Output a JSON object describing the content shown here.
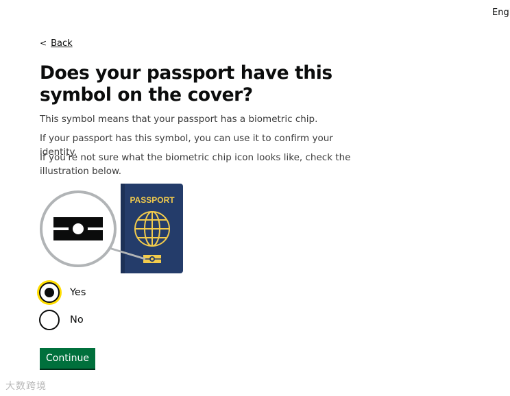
{
  "header": {
    "language_link": "Engli"
  },
  "nav": {
    "back_label": "Back"
  },
  "page": {
    "title": "Does your passport have this symbol on the cover?",
    "paragraphs": [
      "This symbol means that your passport has a biometric chip.",
      "If your passport has this symbol, you can use it to confirm your identity.",
      "If you're not sure what the biometric chip icon looks like, check the illustration below."
    ]
  },
  "illustration": {
    "passport_text": "PASSPORT",
    "passport_color": "#243c6a",
    "emblem_color": "#f2cb4c"
  },
  "form": {
    "options": [
      {
        "label": "Yes",
        "selected": true
      },
      {
        "label": "No",
        "selected": false
      }
    ],
    "continue_label": "Continue"
  },
  "colors": {
    "button": "#00703c",
    "focus": "#ffdd00",
    "text": "#0b0c0c"
  },
  "watermark": "大数跨境"
}
